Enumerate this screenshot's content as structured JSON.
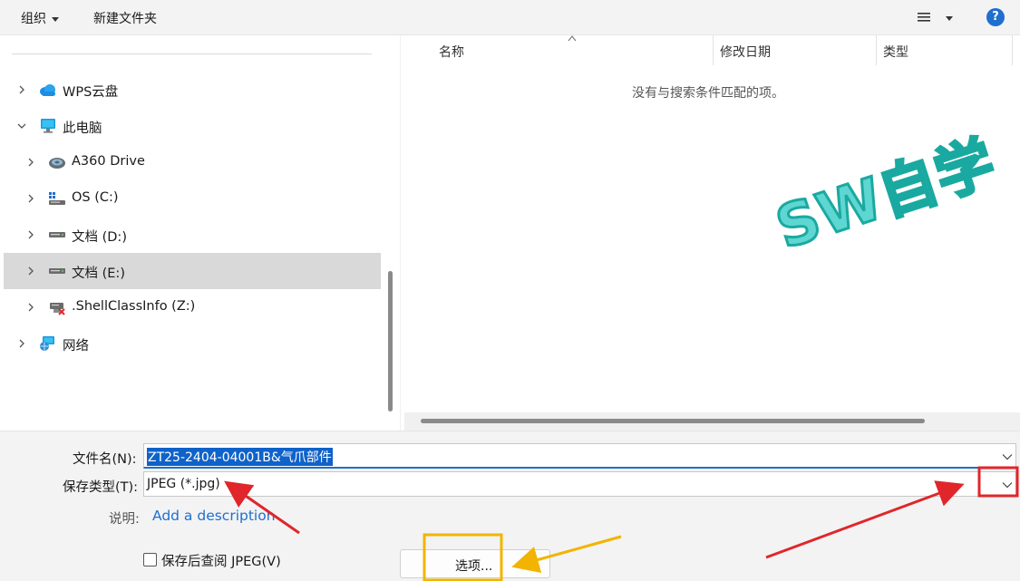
{
  "toolbar": {
    "organize_label": "组织",
    "new_folder_label": "新建文件夹",
    "help_glyph": "?"
  },
  "nav": {
    "items": [
      {
        "label": "WPS云盘",
        "icon": "cloud-icon"
      },
      {
        "label": "此电脑",
        "icon": "computer-icon"
      },
      {
        "label": "A360 Drive",
        "icon": "a360-drive-icon"
      },
      {
        "label": "OS (C:)",
        "icon": "windows-drive-icon"
      },
      {
        "label": "文档 (D:)",
        "icon": "drive-icon"
      },
      {
        "label": "文档 (E:)",
        "icon": "drive-icon",
        "selected": true
      },
      {
        "label": ".ShellClassInfo (Z:)",
        "icon": "network-drive-disconnected-icon"
      },
      {
        "label": "网络",
        "icon": "network-icon"
      }
    ]
  },
  "files": {
    "columns": [
      "名称",
      "修改日期",
      "类型"
    ],
    "empty_message": "没有与搜索条件匹配的项。"
  },
  "watermark": "SW自学",
  "form": {
    "filename_label": "文件名(N):",
    "filename_value": "ZT25-2404-04001B&气爪部件",
    "filetype_label": "保存类型(T):",
    "filetype_value": "JPEG (*.jpg)",
    "description_label": "说明:",
    "description_link": "Add a description",
    "view_after_save_label": "保存后查阅 JPEG(V)",
    "options_button": "选项..."
  },
  "colors": {
    "accent": "#1f6fcf",
    "annotation_red": "#e0262b",
    "annotation_orange": "#f2b400"
  }
}
